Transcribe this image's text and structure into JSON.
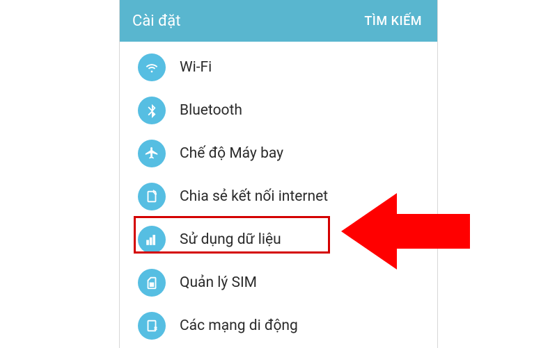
{
  "header": {
    "title": "Cài đặt",
    "search": "TÌM KIẾM"
  },
  "items": [
    {
      "label": "Wi-Fi",
      "icon": "wifi-icon"
    },
    {
      "label": "Bluetooth",
      "icon": "bluetooth-icon"
    },
    {
      "label": "Chế độ Máy bay",
      "icon": "airplane-icon"
    },
    {
      "label": "Chia sẻ kết nối internet",
      "icon": "tether-icon"
    },
    {
      "label": "Sử dụng dữ liệu",
      "icon": "data-usage-icon"
    },
    {
      "label": "Quản lý SIM",
      "icon": "sim-icon"
    },
    {
      "label": "Các mạng di động",
      "icon": "mobile-network-icon"
    }
  ],
  "colors": {
    "accent": "#56bee2",
    "header": "#59b6cf",
    "highlight": "#d40000",
    "arrow": "#ff0000"
  }
}
